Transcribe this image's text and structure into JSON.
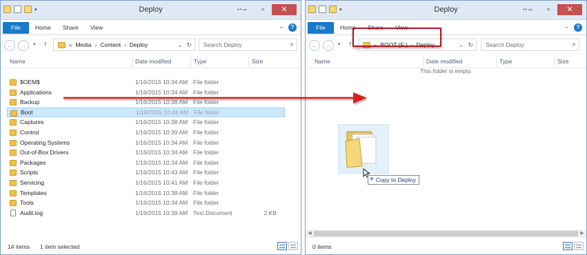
{
  "colors": {
    "accent": "#1979ca",
    "highlight": "#b5161b",
    "arrow": "#d9201f",
    "selection": "#cce8ff"
  },
  "left_window": {
    "title": "Deploy",
    "tabs": {
      "file": "File",
      "home": "Home",
      "share": "Share",
      "view": "View"
    },
    "breadcrumb": {
      "prefix": "«",
      "parts": [
        "Media",
        "Content",
        "Deploy"
      ]
    },
    "search_placeholder": "Search Deploy",
    "columns": {
      "name": "Name",
      "date": "Date modified",
      "type": "Type",
      "size": "Size"
    },
    "files": [
      {
        "name": "$OEM$",
        "date": "1/16/2015 10:34 AM",
        "type": "File folder",
        "size": "",
        "icon": "folder-icon"
      },
      {
        "name": "Applications",
        "date": "1/16/2015 10:34 AM",
        "type": "File folder",
        "size": "",
        "icon": "folder-icon"
      },
      {
        "name": "Backup",
        "date": "1/16/2015 10:38 AM",
        "type": "File folder",
        "size": "",
        "icon": "folder-icon"
      },
      {
        "name": "Boot",
        "date": "1/16/2015 10:43 AM",
        "type": "File folder",
        "size": "",
        "icon": "folder-icon",
        "selected": true
      },
      {
        "name": "Captures",
        "date": "1/16/2015 10:38 AM",
        "type": "File folder",
        "size": "",
        "icon": "folder-icon"
      },
      {
        "name": "Control",
        "date": "1/16/2015 10:39 AM",
        "type": "File folder",
        "size": "",
        "icon": "folder-icon"
      },
      {
        "name": "Operating Systems",
        "date": "1/16/2015 10:34 AM",
        "type": "File folder",
        "size": "",
        "icon": "folder-icon"
      },
      {
        "name": "Out-of-Box Drivers",
        "date": "1/16/2015 10:34 AM",
        "type": "File folder",
        "size": "",
        "icon": "folder-icon"
      },
      {
        "name": "Packages",
        "date": "1/16/2015 10:34 AM",
        "type": "File folder",
        "size": "",
        "icon": "folder-icon"
      },
      {
        "name": "Scripts",
        "date": "1/16/2015 10:43 AM",
        "type": "File folder",
        "size": "",
        "icon": "folder-icon"
      },
      {
        "name": "Servicing",
        "date": "1/16/2015 10:41 AM",
        "type": "File folder",
        "size": "",
        "icon": "folder-icon"
      },
      {
        "name": "Templates",
        "date": "1/16/2015 10:38 AM",
        "type": "File folder",
        "size": "",
        "icon": "folder-icon"
      },
      {
        "name": "Tools",
        "date": "1/16/2015 10:34 AM",
        "type": "File folder",
        "size": "",
        "icon": "folder-icon"
      },
      {
        "name": "Audit.log",
        "date": "1/16/2015 10:39 AM",
        "type": "Text Document",
        "size": "2 KB",
        "icon": "text-document-icon"
      }
    ],
    "status": {
      "count": "14 items",
      "selection": "1 item selected"
    }
  },
  "right_window": {
    "title": "Deploy",
    "tabs": {
      "file": "File",
      "home": "Home",
      "share": "Share",
      "view": "View"
    },
    "breadcrumb": {
      "prefix": "«",
      "parts": [
        "BOOT (F:)",
        "Deploy"
      ]
    },
    "search_placeholder": "Search Deploy",
    "columns": {
      "name": "Name",
      "date": "Date modified",
      "type": "Type",
      "size": "Size"
    },
    "empty_message": "This folder is empty.",
    "status": {
      "count": "0 items"
    }
  },
  "drag": {
    "tooltip": "Copy to Deploy"
  }
}
